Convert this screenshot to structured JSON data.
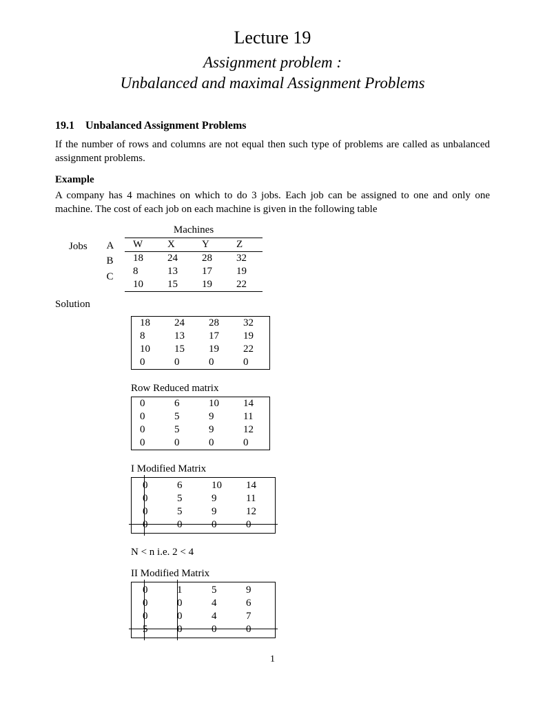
{
  "lecture_title": "Lecture 19",
  "subtitle_line1": "Assignment problem :",
  "subtitle_line2": "Unbalanced and maximal  Assignment Problems",
  "section": {
    "num": "19.1",
    "title": "Unbalanced Assignment Problems"
  },
  "intro_text": "If the number of rows and columns are not equal then such type of problems are called as unbalanced assignment problems.",
  "example_label": "Example",
  "example_text": "A company has 4 machines on which to do 3 jobs. Each job can be assigned to one and only one machine. The cost of each job on each machine is given in the following table",
  "jobs_label": "Jobs",
  "machines_label": "Machines",
  "machine_cols": [
    "W",
    "X",
    "Y",
    "Z"
  ],
  "job_rows": [
    "A",
    "B",
    "C"
  ],
  "cost_table": [
    [
      18,
      24,
      28,
      32
    ],
    [
      8,
      13,
      17,
      19
    ],
    [
      10,
      15,
      19,
      22
    ]
  ],
  "solution_label": "Solution",
  "matrix1": [
    [
      18,
      24,
      28,
      32
    ],
    [
      8,
      13,
      17,
      19
    ],
    [
      10,
      15,
      19,
      22
    ],
    [
      0,
      0,
      0,
      0
    ]
  ],
  "row_reduced_label": "Row Reduced matrix",
  "matrix2": [
    [
      0,
      6,
      10,
      14
    ],
    [
      0,
      5,
      9,
      11
    ],
    [
      0,
      5,
      9,
      12
    ],
    [
      0,
      0,
      0,
      0
    ]
  ],
  "modified1_label": "I Modified Matrix",
  "matrix3": [
    [
      0,
      6,
      10,
      14
    ],
    [
      0,
      5,
      9,
      11
    ],
    [
      0,
      5,
      9,
      12
    ],
    [
      0,
      0,
      0,
      0
    ]
  ],
  "condition_text": "N < n i.e. 2 < 4",
  "modified2_label": "II Modified Matrix",
  "matrix4": [
    [
      0,
      1,
      5,
      9
    ],
    [
      0,
      0,
      4,
      6
    ],
    [
      0,
      0,
      4,
      7
    ],
    [
      5,
      0,
      0,
      0
    ]
  ],
  "page_number": "1"
}
